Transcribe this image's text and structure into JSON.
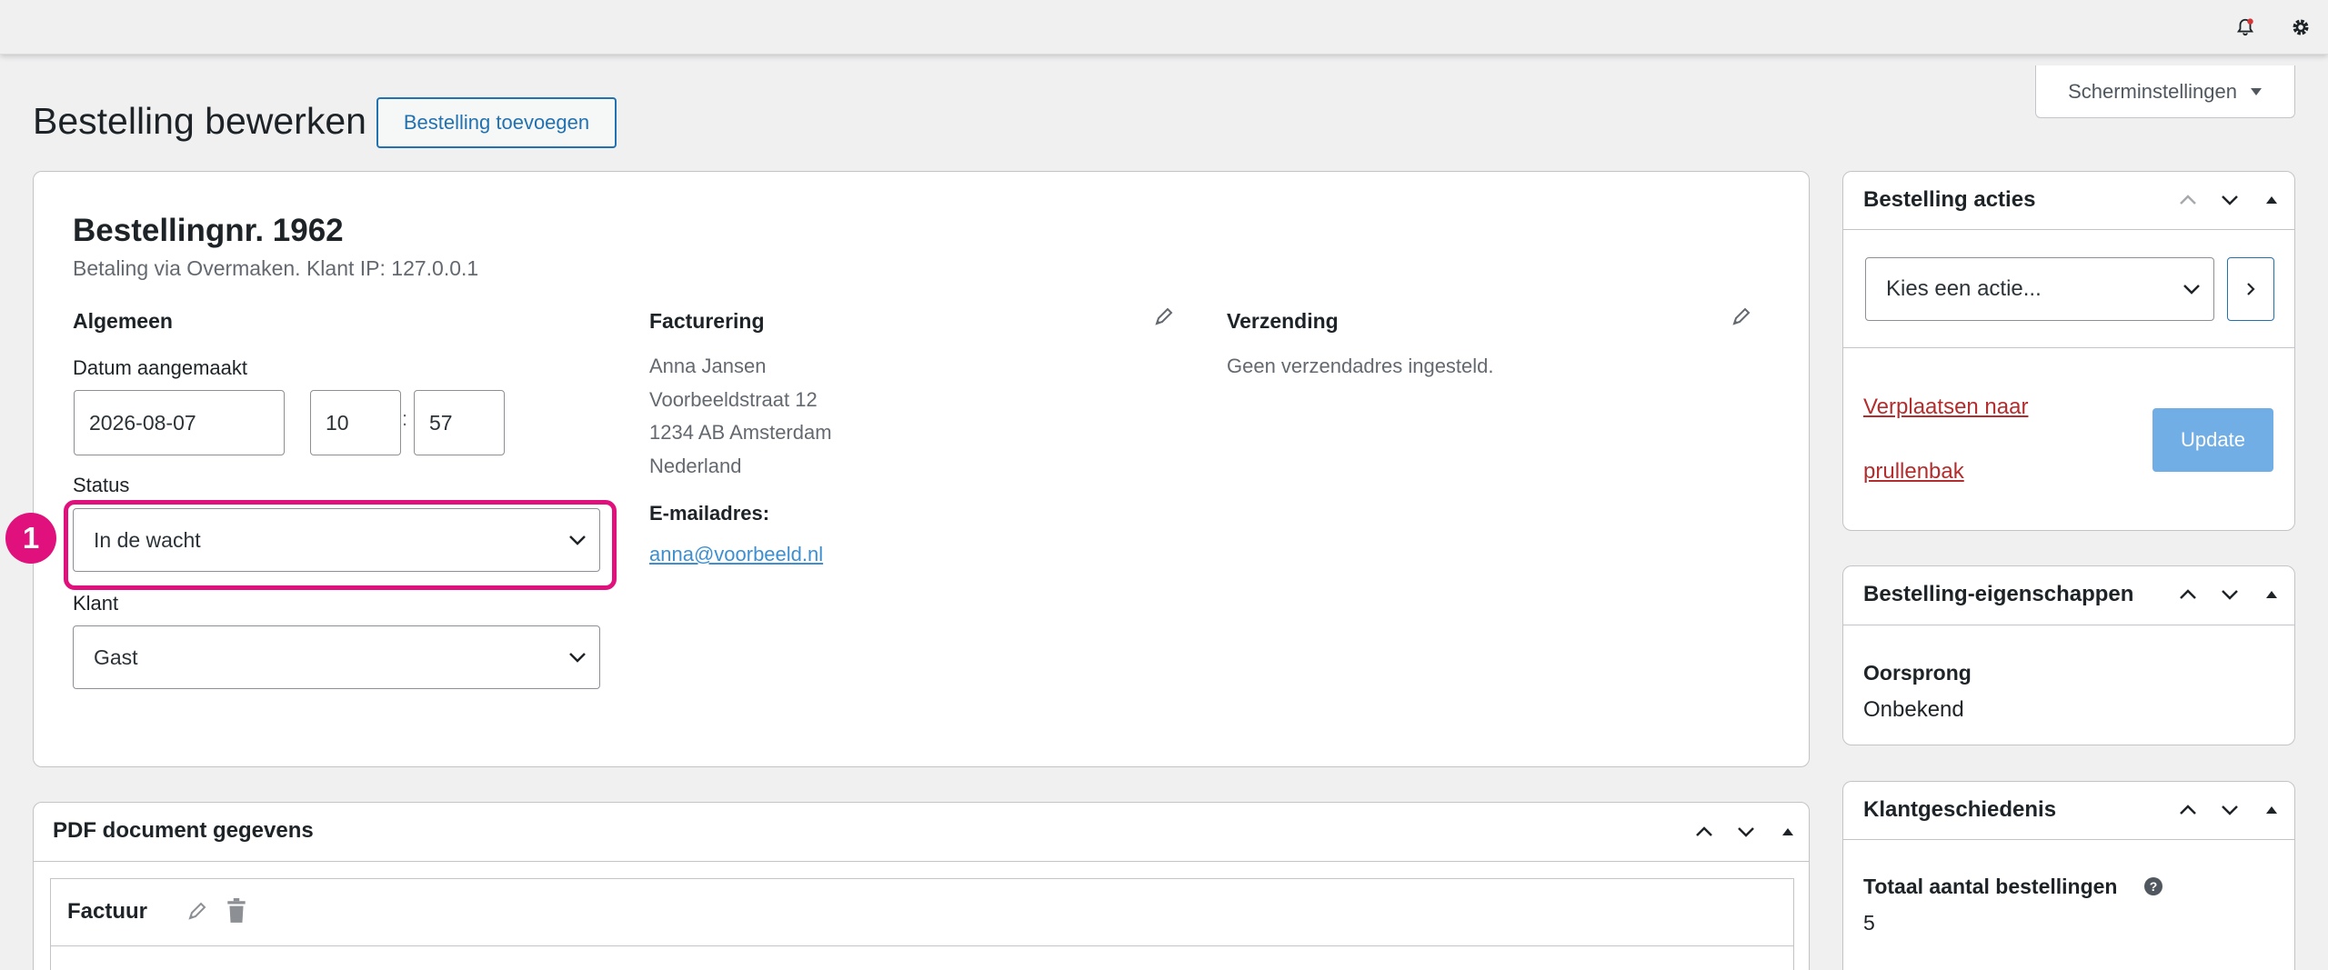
{
  "screen_options": {
    "label": "Scherminstellingen"
  },
  "header": {
    "title": "Bestelling bewerken",
    "add_button": "Bestelling toevoegen"
  },
  "order": {
    "title": "Bestellingnr. 1962",
    "subtitle": "Betaling via Overmaken. Klant IP: 127.0.0.1",
    "general": {
      "heading": "Algemeen",
      "date_label": "Datum aangemaakt",
      "date_value": "2026-08-07",
      "hour_value": "10",
      "time_sep": ":",
      "minute_value": "57",
      "status_label": "Status",
      "status_value": "In de wacht",
      "customer_label": "Klant",
      "customer_value": "Gast"
    },
    "billing": {
      "heading": "Facturering",
      "address": [
        "Anna Jansen",
        "Voorbeeldstraat 12",
        "1234 AB Amsterdam",
        "Nederland"
      ],
      "email_label": "E-mailadres:",
      "email": "anna@voorbeeld.nl"
    },
    "shipping": {
      "heading": "Verzending",
      "note": "Geen verzendadres ingesteld."
    }
  },
  "annotation": {
    "badge": "1",
    "color": "#e0117d"
  },
  "pdf_panel": {
    "title": "PDF document gegevens",
    "invoice_label": "Factuur"
  },
  "actions_panel": {
    "title": "Bestelling acties",
    "select_placeholder": "Kies een actie...",
    "trash_link_line1": "Verplaatsen naar",
    "trash_link_line2": "prullenbak",
    "update_button": "Update"
  },
  "properties_panel": {
    "title": "Bestelling-eigenschappen",
    "origin_label": "Oorsprong",
    "origin_value": "Onbekend"
  },
  "history_panel": {
    "title": "Klantgeschiedenis",
    "total_label": "Totaal aantal bestellingen",
    "total_value": "5"
  },
  "colors": {
    "accent": "#2271b1",
    "link": "#3d8fd1",
    "danger": "#b32d2e",
    "highlight": "#e0117d",
    "update_button": "#72aee6"
  }
}
